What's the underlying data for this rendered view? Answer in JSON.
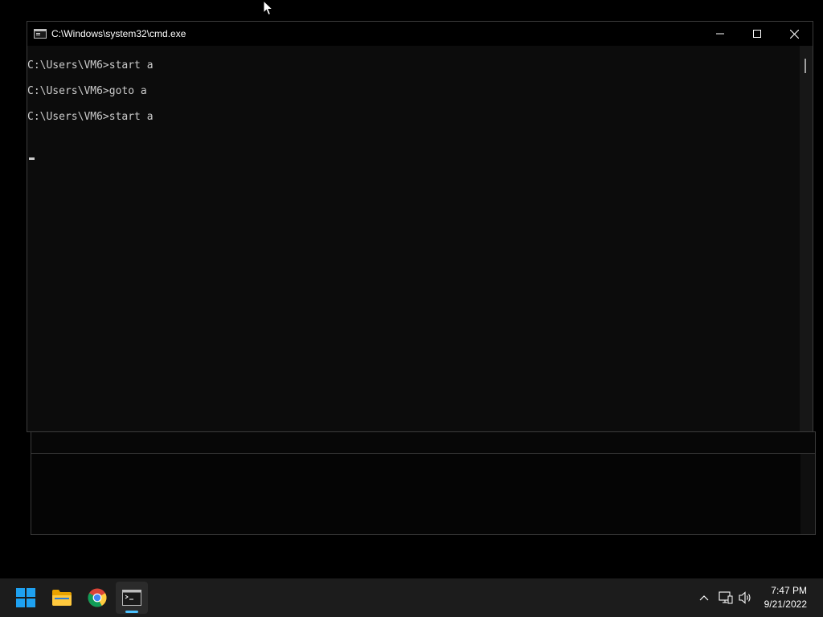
{
  "window": {
    "title": "C:\\Windows\\system32\\cmd.exe",
    "icon": "console-icon"
  },
  "console": {
    "lines": [
      "C:\\Users\\VM6>start a",
      "C:\\Users\\VM6>goto a",
      "C:\\Users\\VM6>start a"
    ]
  },
  "taskbar": {
    "apps": [
      {
        "name": "start",
        "icon": "windows-start-icon"
      },
      {
        "name": "file-explorer",
        "icon": "folder-icon"
      },
      {
        "name": "chrome",
        "icon": "chrome-icon"
      },
      {
        "name": "command-prompt",
        "icon": "console-icon",
        "active": true
      }
    ],
    "tray_icons": [
      "chevron-up-icon",
      "network-icon",
      "volume-icon"
    ],
    "clock": {
      "time": "7:47 PM",
      "date": "9/21/2022"
    }
  },
  "colors": {
    "console_bg": "#0c0c0c",
    "console_text": "#cccccc",
    "titlebar_bg": "#000000",
    "taskbar_bg": "#1c1c1c",
    "accent": "#4cc2ff",
    "start_blue": "#1ea1f1"
  }
}
